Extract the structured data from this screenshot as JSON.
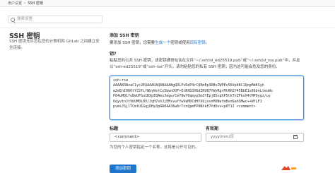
{
  "breadcrumb": {
    "parent": "用户设置",
    "separator": ">",
    "current": "SSH 密钥"
  },
  "search": {
    "placeholder": "搜索设置"
  },
  "page": {
    "title": "SSH 密钥",
    "description": "SSH 密钥允许您在您的计算机和 GitLab 之间建立安全连接。"
  },
  "add_section": {
    "heading": "添加 SSH 密钥",
    "desc_prefix": "要添加 SSH 密钥，您需要",
    "link_generate": "生成一个",
    "desc_middle": "密钥或使用",
    "link_existing": "现有密钥",
    "desc_suffix": "。"
  },
  "key_field": {
    "label": "钥?",
    "help": "粘贴您的公共 SSH 密钥，该密钥通常包含在文件“~/.ssh/id_ed25519.pub”或“~/.ssh/id_rsa.pub”中，并且以“ssh-ed25519”或“ssh-rsa”开头。请勿粘贴您的私有 SSH 密钥，因为这可能会危及您的身份。",
    "value": "ssh-rsa\nAAAAB3NzaC1yc2EAAAADAQABAAABgQDLPvRdP4rC8EmEp3DBvZWPEs56Vp08C1QnpMdKSyh\nw2eEnI066tYZ2fLfWbyWstCx5bwnOOF+EtNXD3X6dZHUB7fWyRgrMtRH2Y45BbE1x86bnLteuWu\nP84uMQ1fuBeUFGu1DXpEQAmsJegw/CmY0wY0qmyp5m3YEpj85xpXP5tkTnZFkoX4tMPOygz/uy\nUqyvtnJtVbUM0i0V/JqH7shJjEMsvufYwVeMDCdHYXUjovnMXNefmBsmSahSMwc++WYLF1\npvmsJSjlTCmtU1GqjDHp3pRR04A36w6rTcnQpmFP0NhkE7fdDvv+p0T1I <comment>"
  },
  "title_field": {
    "label": "标题",
    "placeholder": "<comment>",
    "help": "为您的个人密钥指定一个名称。这将是公开可见的。"
  },
  "expires_field": {
    "label": "有效期",
    "placeholder": "yyyy/mm/日"
  },
  "submit_label": "添加密钥",
  "colors": {
    "accent": "#1f75cb",
    "focus": "#3f8de0",
    "text": "#303030"
  }
}
